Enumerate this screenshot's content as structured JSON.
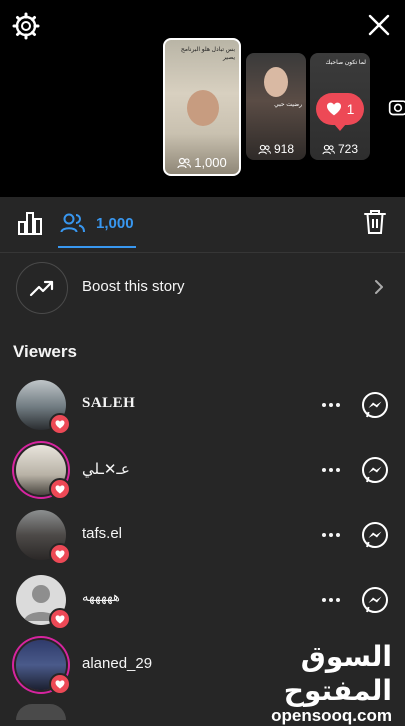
{
  "top_bar": {
    "settings_icon": "gear-icon",
    "close_icon": "close-icon"
  },
  "story_thumbnails": [
    {
      "viewers": "1,000",
      "caption": "بس تبادل هلو البرنامج يصير",
      "selected": true
    },
    {
      "viewers": "918",
      "caption": "رضيت حبي"
    },
    {
      "viewers": "723",
      "caption": "لما تكون صاحبك"
    }
  ],
  "like_bubble": {
    "count": "1"
  },
  "tabs": {
    "insights_icon": "bar-chart-icon",
    "viewers_count": "1,000",
    "delete_icon": "trash-icon"
  },
  "boost": {
    "label": "Boost this story"
  },
  "viewers_title": "Viewers",
  "viewers": [
    {
      "name": "SALEH ",
      "liked": true,
      "ring": false
    },
    {
      "name": "عـ✕ـلي",
      "liked": true,
      "ring": true
    },
    {
      "name": "tafs.el",
      "liked": true,
      "ring": false
    },
    {
      "name": "هههههه",
      "liked": true,
      "ring": false
    },
    {
      "name": "alaned_29",
      "liked": true,
      "ring": true
    }
  ],
  "watermark": {
    "arabic": "السوق المفتوح",
    "latin": "opensooq.com"
  },
  "colors": {
    "accent": "#3897f0",
    "like": "#ed4956",
    "background": "#262626"
  }
}
